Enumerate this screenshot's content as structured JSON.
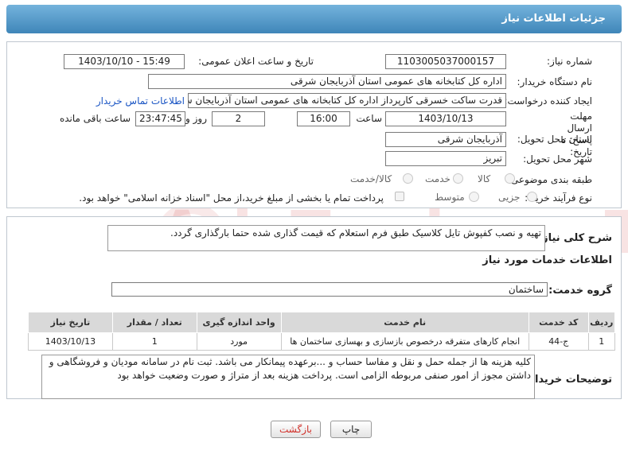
{
  "header": {
    "title": "جزئیات اطلاعات نیاز"
  },
  "fields": {
    "need_number_label": "شماره نیاز:",
    "need_number": "1103005037000157",
    "announce_label": "تاریخ و ساعت اعلان عمومی:",
    "announce_value": "1403/10/10 - 15:49",
    "buyer_label": "نام دستگاه خریدار:",
    "buyer_value": "اداره کل کتابخانه های عمومی استان آذربایجان شرقی",
    "creator_label": "ایجاد کننده درخواست:",
    "creator_value": "قدرت ساکت خسرقی کارپرداز اداره کل کتابخانه های عمومی استان آذربایجان ش",
    "contact_link": "اطلاعات تماس خریدار",
    "deadline_label": "مهلت ارسال پاسخ: تا تاریخ:",
    "deadline_date": "1403/10/13",
    "time_label": "ساعت",
    "deadline_time": "16:00",
    "days_value": "2",
    "days_label": "روز و",
    "remaining_value": "23:47:45",
    "remaining_label": "ساعت باقی مانده",
    "province_label": "استان محل تحویل:",
    "province_value": "آذربایجان شرقی",
    "city_label": "شهر محل تحویل:",
    "city_value": "تبریز",
    "category_label": "طبقه بندی موضوعی:",
    "category_options": [
      "کالا",
      "خدمت",
      "کالا/خدمت"
    ],
    "process_label": "نوع فرآیند خرید :",
    "process_options": [
      "جزیی",
      "متوسط"
    ],
    "payment_note": "پرداخت تمام یا بخشی از مبلغ خرید،از محل \"اسناد خزانه اسلامی\" خواهد بود."
  },
  "details": {
    "summary_label": "شرح کلی نیاز:",
    "summary_value": "تهیه و نصب کفپوش تایل کلاسیک طبق فرم استعلام که قیمت گذاری شده حتما بارگذاری گردد.",
    "services_heading": "اطلاعات خدمات مورد نیاز",
    "service_group_label": "گروه خدمت:",
    "service_group_value": "ساختمان",
    "table": {
      "headers": [
        "ردیف",
        "کد خدمت",
        "نام خدمت",
        "واحد اندازه گیری",
        "تعداد / مقدار",
        "تاریخ نیاز"
      ],
      "rows": [
        [
          "1",
          "ج-44",
          "انجام کارهای متفرقه درخصوص بازسازی و بهسازی ساختمان ها",
          "مورد",
          "1",
          "1403/10/13"
        ]
      ]
    },
    "buyer_notes_label": "توضیحات خریدار:",
    "buyer_notes_value": "کلیه هزینه ها از جمله حمل و نقل و مفاسا حساب و ...برعهده پیمانکار می باشد. ثبت نام در سامانه مودیان و فروشگاهی و داشتن مجوز از امور صنفی مربوطه الزامی است. پرداخت هزینه بعد از متراژ و صورت وضعیت  خواهد بود"
  },
  "buttons": {
    "print": "چاپ",
    "back": "بازگشت"
  },
  "watermark": "AriaTender.neT",
  "colors": {
    "header": "#4a8fc2",
    "link": "#1a55c4",
    "back_text": "#d0302a"
  }
}
